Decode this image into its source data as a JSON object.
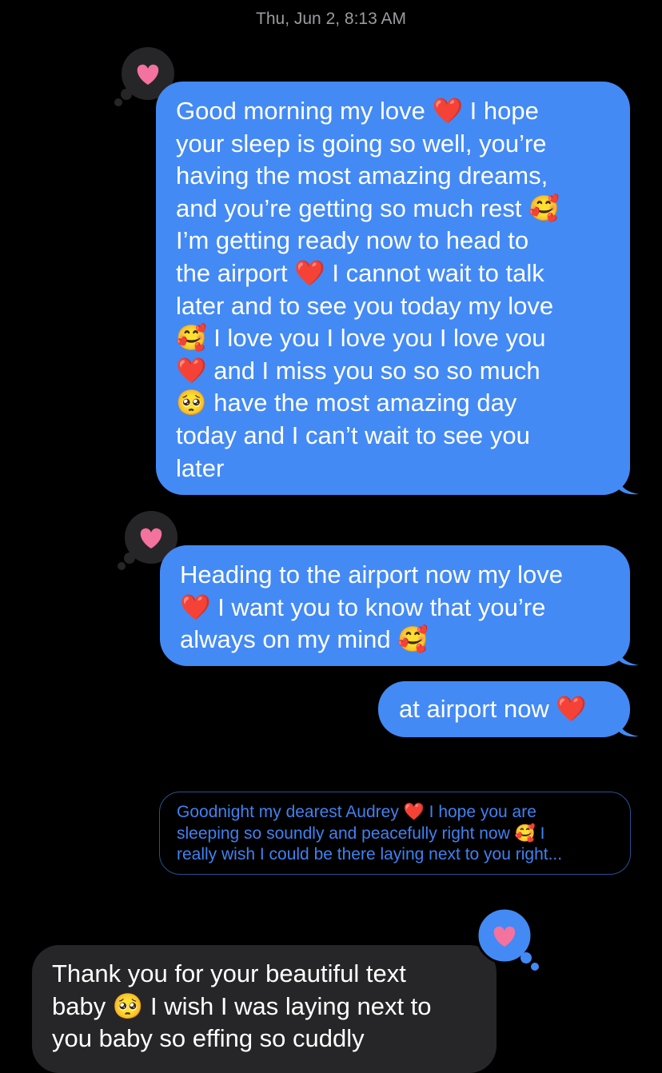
{
  "timestamp": "Thu, Jun 2, 8:13 AM",
  "colors": {
    "sent_bubble": "#438af5",
    "received_bubble": "#262628",
    "reply_preview_text": "#3f82f0",
    "tapback_heart": "#f3729e",
    "background": "#000000"
  },
  "messages": [
    {
      "direction": "sent",
      "reaction": "heart",
      "lines": [
        "Good morning my love ❤️ I hope",
        "your sleep is going so well, you’re",
        "having the most amazing dreams,",
        "and you’re getting so much rest 🥰",
        "I’m getting ready now to head to",
        "the airport ❤️ I cannot wait to talk",
        "later and to see you today my love",
        "🥰 I love you I love you I love you",
        "❤️ and I miss you so so so much",
        "🥺 have the most amazing day",
        "today and I can’t wait to see you",
        "later"
      ]
    },
    {
      "direction": "sent",
      "reaction": "heart",
      "lines": [
        "Heading to the airport now my love",
        "❤️ I want you to know that you’re",
        "always on my mind 🥰"
      ]
    },
    {
      "direction": "sent",
      "lines": [
        "at airport now ❤️"
      ]
    }
  ],
  "reply_preview": {
    "lines": [
      "Goodnight my dearest Audrey ❤️ I hope you are",
      "sleeping so soundly and peacefully right now 🥰 I",
      "really wish I could be there laying next to you right..."
    ]
  },
  "received_message": {
    "direction": "received",
    "reaction": "heart",
    "lines": [
      "Thank you for your beautiful text",
      "baby 🥺 I wish I was laying next to",
      "you baby so effing so cuddly"
    ]
  }
}
